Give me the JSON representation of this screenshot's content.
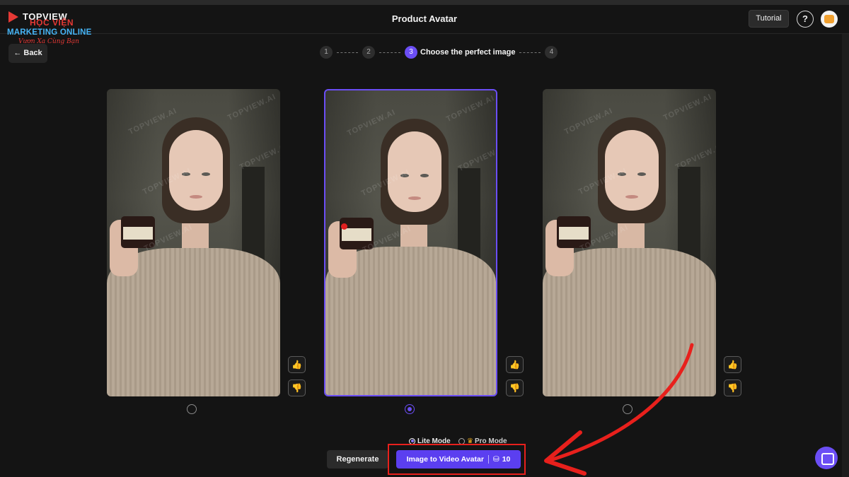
{
  "header": {
    "title": "Product Avatar",
    "tutorial_label": "Tutorial",
    "help_label": "?"
  },
  "brand": {
    "top": "TOPVIEW",
    "overlay": "HỌC VIỆN",
    "name": "MARKETING ONLINE",
    "tagline": "Vươn Xa Cùng Bạn"
  },
  "nav": {
    "back_label": "Back"
  },
  "steps": [
    {
      "number": "1"
    },
    {
      "number": "2"
    },
    {
      "number": "3",
      "label": "Choose the perfect image",
      "active": true
    },
    {
      "number": "4"
    }
  ],
  "images": [
    {
      "watermark": "TOPVIEW.AI",
      "selected": false
    },
    {
      "watermark": "TOPVIEW.AI",
      "selected": true
    },
    {
      "watermark": "TOPVIEW.AI",
      "selected": false
    }
  ],
  "feedback": {
    "like_icon": "thumbs-up-icon",
    "dislike_icon": "thumbs-down-icon"
  },
  "mode": {
    "lite_label": "Lite Mode",
    "pro_label": "Pro Mode",
    "selected": "Lite Mode"
  },
  "actions": {
    "regenerate_label": "Regenerate",
    "convert_label": "Image to Video Avatar",
    "credits": "10"
  },
  "colors": {
    "accent": "#5b3ff0",
    "background": "#141414",
    "annotation": "#e8201c"
  }
}
